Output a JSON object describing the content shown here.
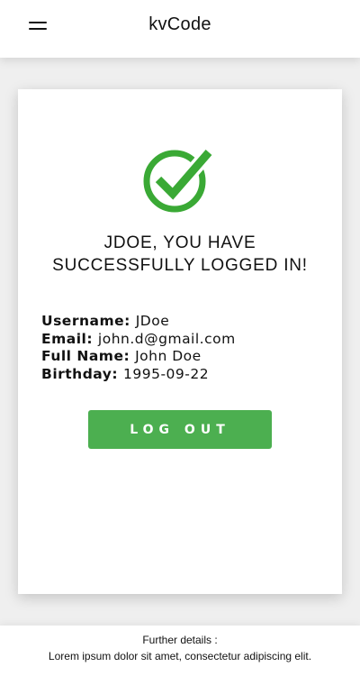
{
  "header": {
    "title": "kvCode",
    "menu_icon": "hamburger-menu-icon"
  },
  "card": {
    "success_icon": "checkmark-circle-icon",
    "heading_line1": "JDOE, YOU HAVE",
    "heading_line2": "SUCCESSFULLY LOGGED IN!",
    "details": [
      {
        "label": "Username:",
        "value": "JDoe"
      },
      {
        "label": "Email:",
        "value": "john.d@gmail.com"
      },
      {
        "label": "Full Name:",
        "value": "John Doe"
      },
      {
        "label": "Birthday:",
        "value": "1995-09-22"
      }
    ],
    "logout_label": "LOG OUT"
  },
  "footer": {
    "title": "Further details :",
    "text": "Lorem ipsum dolor sit amet, consectetur adipiscing elit."
  },
  "colors": {
    "accent": "#4caf50",
    "check_green": "#3aa935",
    "background": "#efefef"
  }
}
